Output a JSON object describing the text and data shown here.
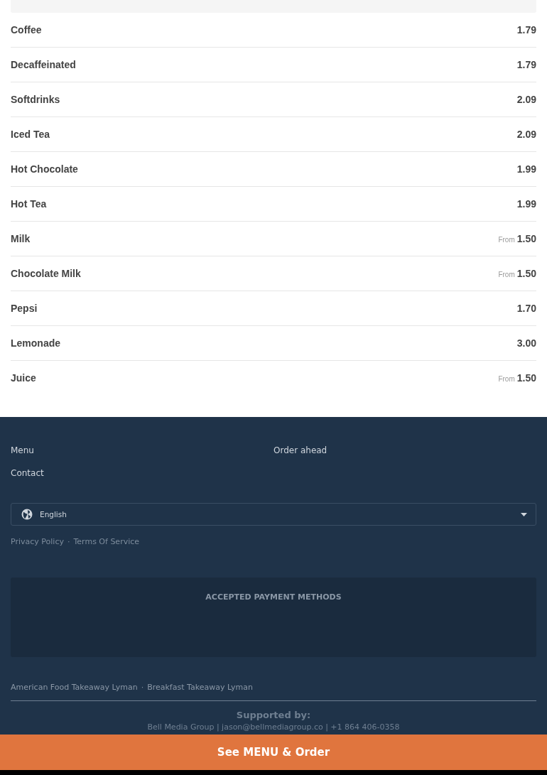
{
  "menu_items": [
    {
      "name": "Coffee",
      "price": "1.79"
    },
    {
      "name": "Decaffeinated",
      "price": "1.79"
    },
    {
      "name": "Softdrinks",
      "price": "2.09"
    },
    {
      "name": "Iced Tea",
      "price": "2.09"
    },
    {
      "name": "Hot Chocolate",
      "price": "1.99"
    },
    {
      "name": "Hot Tea",
      "price": "1.99"
    },
    {
      "name": "Milk",
      "prefix": "From",
      "price": "1.50"
    },
    {
      "name": "Chocolate Milk",
      "prefix": "From",
      "price": "1.50"
    },
    {
      "name": "Pepsi",
      "price": "1.70"
    },
    {
      "name": "Lemonade",
      "price": "3.00"
    },
    {
      "name": "Juice",
      "prefix": "From",
      "price": "1.50"
    }
  ],
  "footer": {
    "links": [
      "Menu",
      "Order ahead",
      "Contact"
    ],
    "language": "English",
    "legal_links": [
      "Privacy Policy",
      "Terms Of Service"
    ],
    "separator": "·",
    "payment_heading": "ACCEPTED PAYMENT METHODS",
    "tags": [
      "American Food Takeaway Lyman",
      "Breakfast Takeaway Lyman"
    ],
    "supported_heading": "Supported by:",
    "supported_line": "Bell Media Group | jason@bellmediagroup.co | +1 864 406-0358"
  },
  "order_button": "See MENU & Order"
}
